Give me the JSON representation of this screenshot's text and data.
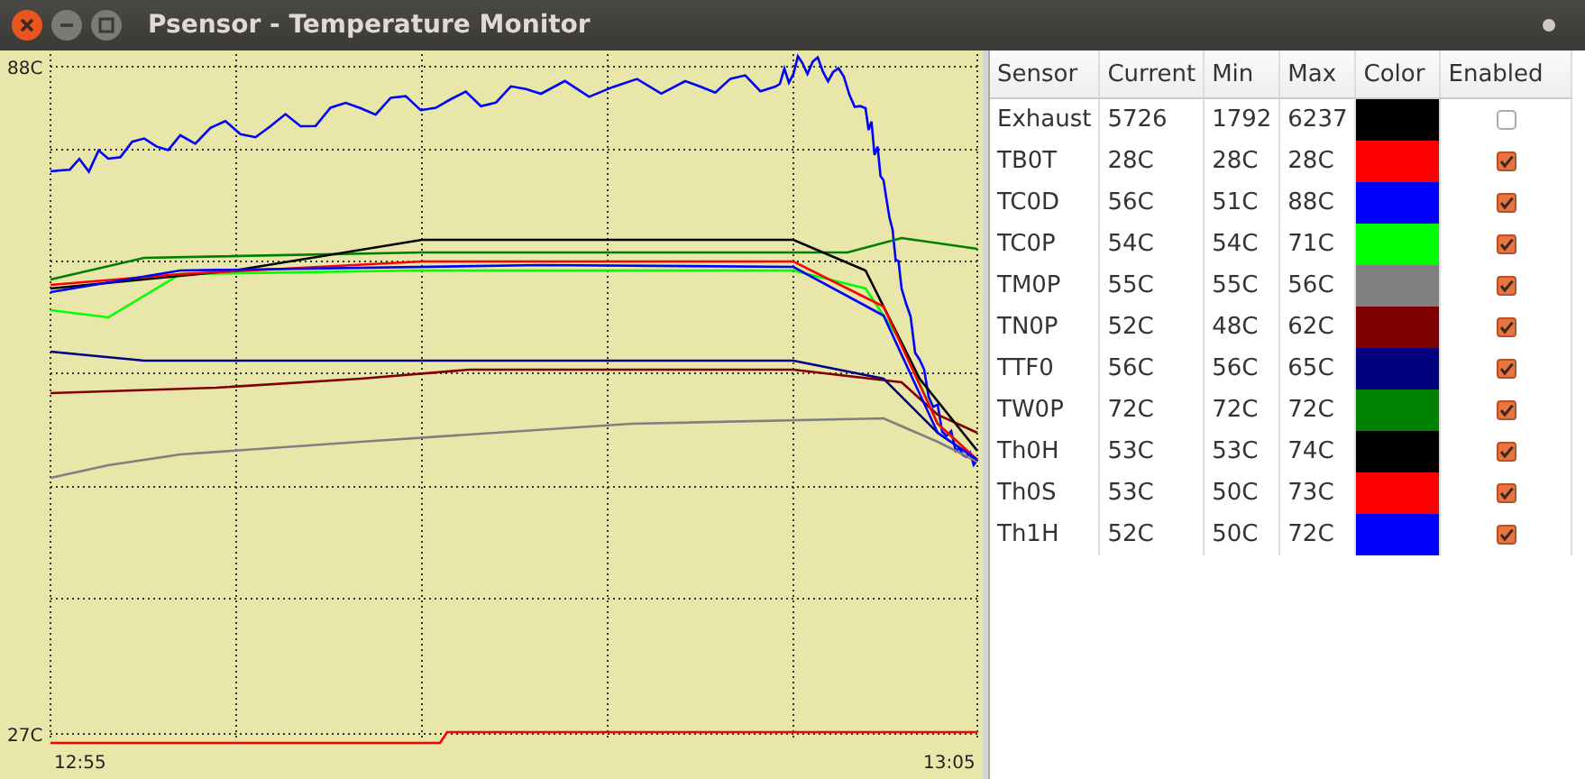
{
  "window": {
    "title": "Psensor - Temperature Monitor"
  },
  "graph": {
    "y_max_label": "88C",
    "y_min_label": "27C",
    "x_start_label": "12:55",
    "x_end_label": "13:05"
  },
  "table": {
    "columns": [
      "Sensor",
      "Current",
      "Min",
      "Max",
      "Color",
      "Enabled"
    ],
    "rows": [
      {
        "sensor": "Exhaust",
        "current": "5726",
        "min": "1792",
        "max": "6237",
        "color": "#000000",
        "enabled": false
      },
      {
        "sensor": "TB0T",
        "current": "28C",
        "min": "28C",
        "max": "28C",
        "color": "#ff0000",
        "enabled": true
      },
      {
        "sensor": "TC0D",
        "current": "56C",
        "min": "51C",
        "max": "88C",
        "color": "#0000ff",
        "enabled": true
      },
      {
        "sensor": "TC0P",
        "current": "54C",
        "min": "54C",
        "max": "71C",
        "color": "#00ff00",
        "enabled": true
      },
      {
        "sensor": "TM0P",
        "current": "55C",
        "min": "55C",
        "max": "56C",
        "color": "#808080",
        "enabled": true
      },
      {
        "sensor": "TN0P",
        "current": "52C",
        "min": "48C",
        "max": "62C",
        "color": "#800000",
        "enabled": true
      },
      {
        "sensor": "TTF0",
        "current": "56C",
        "min": "56C",
        "max": "65C",
        "color": "#000080",
        "enabled": true
      },
      {
        "sensor": "TW0P",
        "current": "72C",
        "min": "72C",
        "max": "72C",
        "color": "#008000",
        "enabled": true
      },
      {
        "sensor": "Th0H",
        "current": "53C",
        "min": "53C",
        "max": "74C",
        "color": "#000000",
        "enabled": true
      },
      {
        "sensor": "Th0S",
        "current": "53C",
        "min": "50C",
        "max": "73C",
        "color": "#ff0000",
        "enabled": true
      },
      {
        "sensor": "Th1H",
        "current": "52C",
        "min": "50C",
        "max": "72C",
        "color": "#0000ff",
        "enabled": true
      }
    ]
  }
}
